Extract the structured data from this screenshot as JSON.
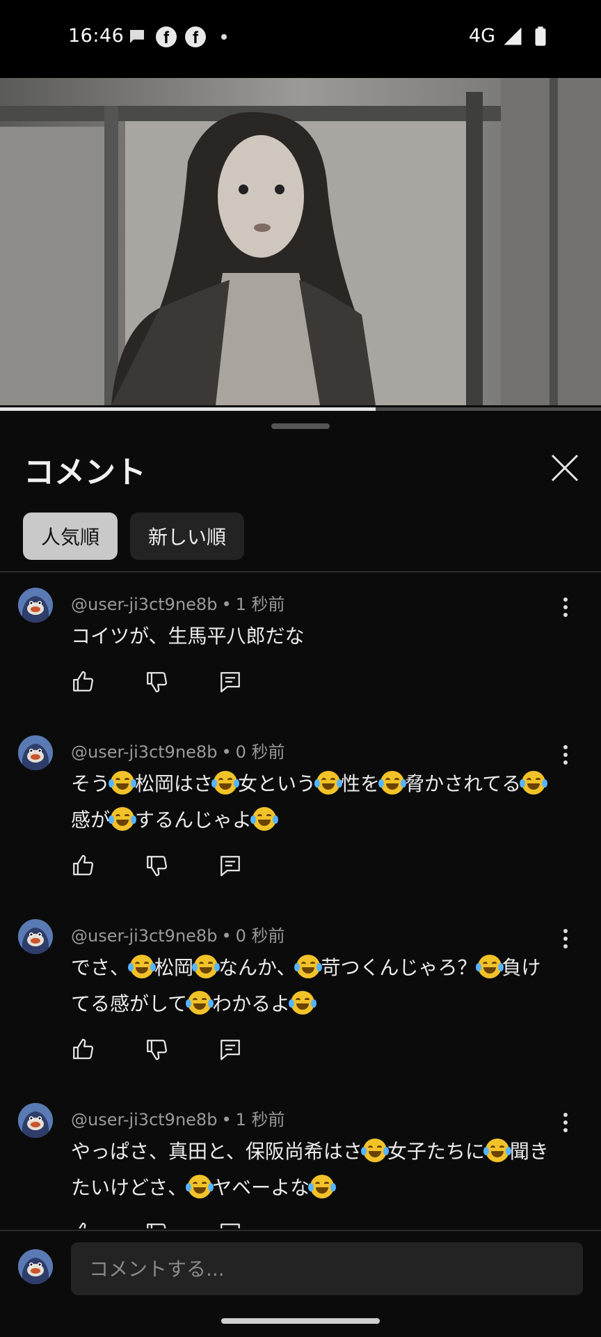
{
  "status_bar": {
    "time": "16:46",
    "network": "4G",
    "icons": [
      "chat-bubble-icon",
      "facebook-icon",
      "facebook-icon",
      "dot-icon",
      "signal-icon",
      "battery-icon"
    ]
  },
  "video": {
    "progress_percent": 62.5
  },
  "comments_sheet": {
    "title": "コメント",
    "sort_chips": [
      {
        "label": "人気順",
        "active": true
      },
      {
        "label": "新しい順",
        "active": false
      }
    ],
    "comments": [
      {
        "author": "@user-ji3ct9ne8b",
        "separator": "•",
        "time": "1 秒前",
        "text": [
          "コイツが、生馬平八郎だな"
        ]
      },
      {
        "author": "@user-ji3ct9ne8b",
        "separator": "•",
        "time": "0 秒前",
        "text": [
          "そう",
          "😂",
          "松岡はさ",
          "😂",
          "女という",
          "😂",
          "性を",
          "😂",
          "脅かされてる",
          "😂",
          "感が",
          "😂",
          "するんじゃよ",
          "😂"
        ]
      },
      {
        "author": "@user-ji3ct9ne8b",
        "separator": "•",
        "time": "0 秒前",
        "text": [
          "でさ、",
          "😂",
          "松岡",
          "😂",
          "なんか、",
          "😂",
          "苛つくんじゃろ？",
          "😂",
          "負けてる感がして",
          "😂",
          "わかるよ",
          "😂"
        ]
      },
      {
        "author": "@user-ji3ct9ne8b",
        "separator": "•",
        "time": "1 秒前",
        "text": [
          "やっぱさ、真田と、保阪尚希はさ",
          "😂",
          "女子たちに",
          "😂",
          "聞きたいけどさ、",
          "😂",
          "ヤベーよな",
          "😂"
        ]
      }
    ],
    "input": {
      "placeholder": "コメントする..."
    }
  }
}
